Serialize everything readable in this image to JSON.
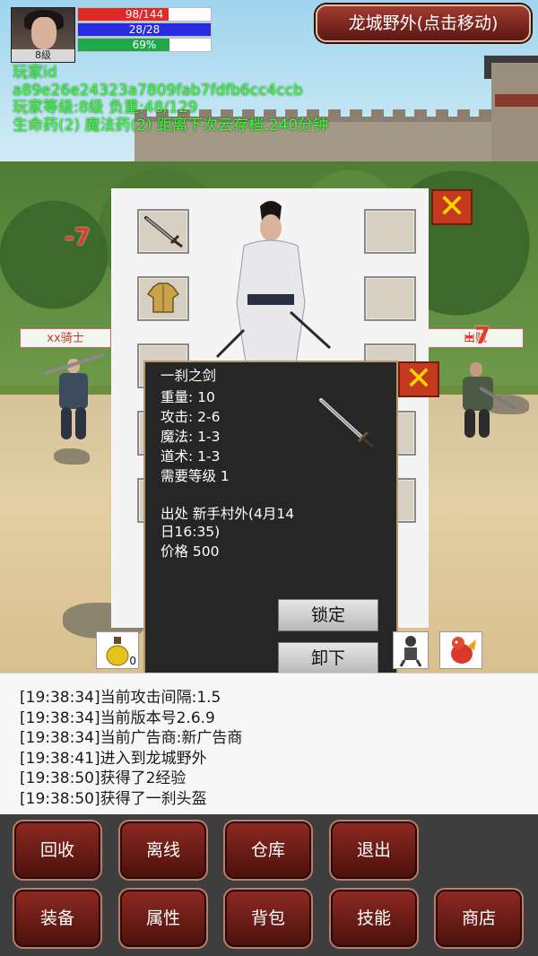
{
  "player": {
    "level_label": "8级",
    "hp_text": "98/144",
    "hp_fraction": 0.68,
    "mp_text": "28/28",
    "mp_fraction": 1.0,
    "exp_text": "69%",
    "exp_fraction": 0.69,
    "info_id_label": "玩家id",
    "info_id_value": "a89e26e24323a7809fab7fdfb6cc4ccb",
    "info_level_weight": "玩家等级:8级 负重:48/129",
    "info_potions": "生命药(2) 魔法药(2) 距离下次云存档:240分钟"
  },
  "location_button": "龙城野外(点击移动)",
  "scene": {
    "left_name": "xx骑士",
    "right_name": "山贼",
    "damage_left": "-7",
    "damage_right": "-7"
  },
  "equip_panel": {
    "close_symbol": "✕",
    "lock_ghost_text": "锁定"
  },
  "tooltip": {
    "name": "一刹之剑",
    "weight": "重量: 10",
    "attack": "攻击: 2-6",
    "magic": "魔法: 1-3",
    "taoism": "道术: 1-3",
    "level_req": "需要等级 1",
    "origin_1": "出处 新手村外(4月14",
    "origin_2": "日16:35)",
    "price": "价格 500",
    "lock_button": "锁定",
    "unequip_button": "卸下",
    "close_symbol": "✕"
  },
  "quick_items": {
    "potion_count": "0"
  },
  "log": [
    "[19:38:34]当前攻击间隔:1.5",
    "[19:38:34]当前版本号2.6.9",
    "[19:38:34]当前广告商:新广告商",
    "[19:38:41]进入到龙城野外",
    "[19:38:50]获得了2经验",
    "[19:38:50]获得了一刹头盔"
  ],
  "menu": {
    "row1": [
      "回收",
      "离线",
      "仓库",
      "退出"
    ],
    "row2": [
      "装备",
      "属性",
      "背包",
      "技能",
      "商店"
    ]
  },
  "colors": {
    "hp": "#e02a2a",
    "mp": "#2a2ae0",
    "exp": "#1ea84a",
    "info_text": "#3bff3b",
    "damage": "#e53a2a",
    "menu_button": "#8e2a22"
  }
}
